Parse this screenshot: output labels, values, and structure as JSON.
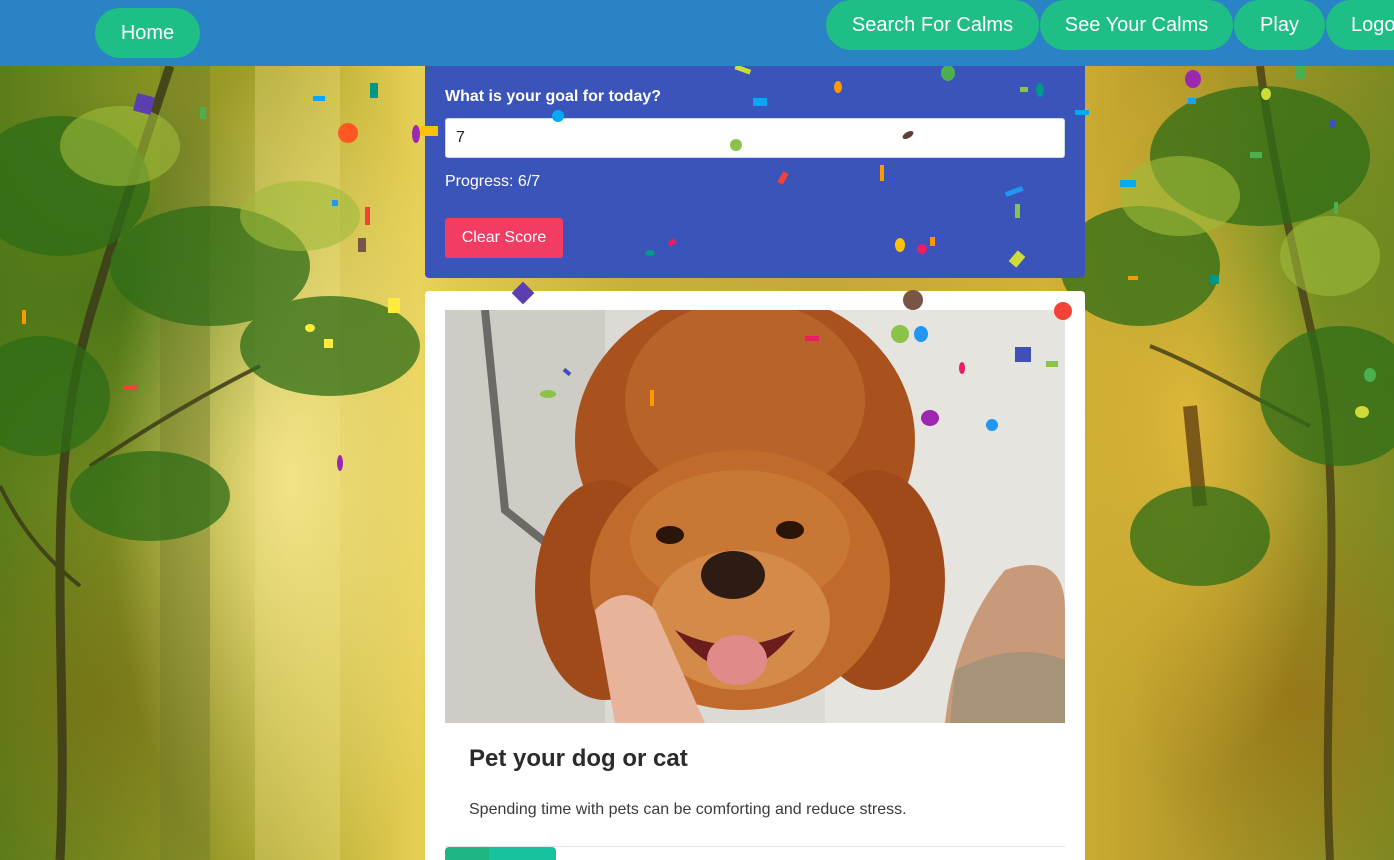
{
  "nav": {
    "home": "Home",
    "search": "Search For Calms",
    "see": "See Your Calms",
    "play": "Play",
    "logout": "Logo"
  },
  "goal": {
    "label": "What is your goal for today?",
    "value": "7",
    "progress": "Progress: 6/7",
    "clear_label": "Clear Score"
  },
  "card": {
    "title": "Pet your dog or cat",
    "description": "Spending time with pets can be comforting and reduce stress.",
    "image_name": "golden-retriever-photo"
  },
  "colors": {
    "navbar": "#2a83c4",
    "nav_button": "#1fbe86",
    "goal_panel": "#3b54b9",
    "clear_button": "#f23c63"
  },
  "background_name": "forest-background",
  "effect_name": "confetti"
}
